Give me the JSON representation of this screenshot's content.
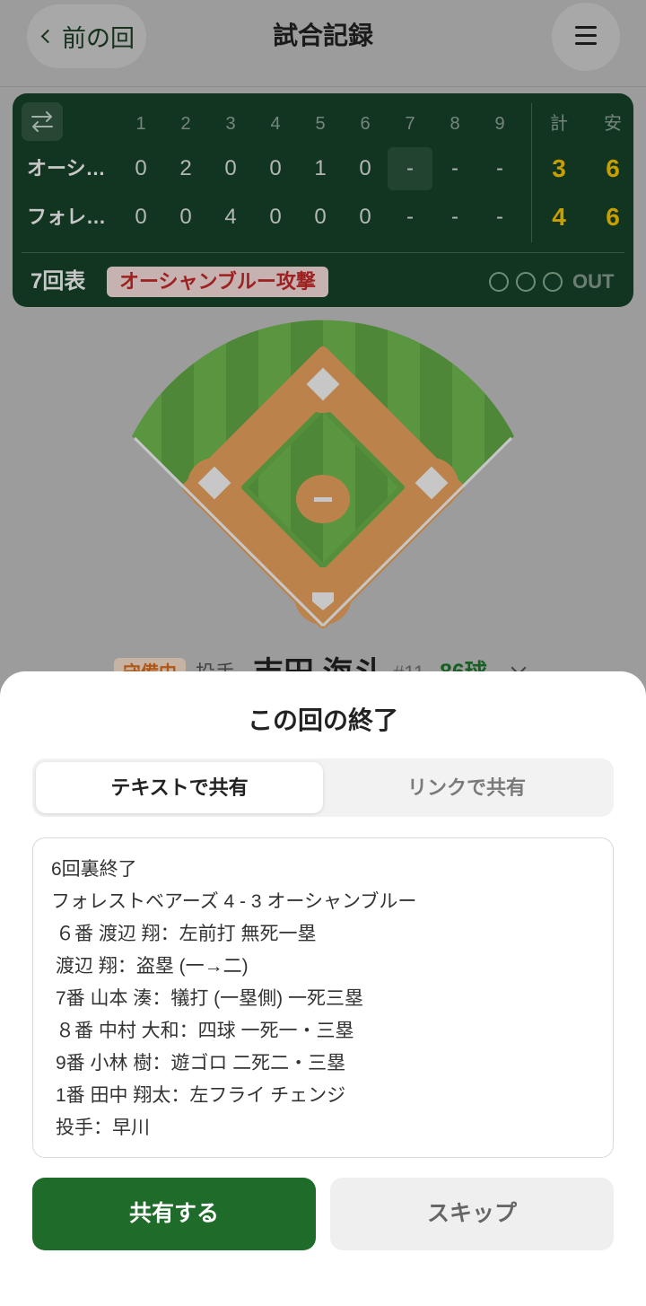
{
  "header": {
    "back_icon": "chevron-left-icon",
    "back_label": "前の回",
    "title": "試合記録",
    "menu_icon": "menu-icon"
  },
  "scoreboard": {
    "swap_icon": "swap-icon",
    "innings": [
      "1",
      "2",
      "3",
      "4",
      "5",
      "6",
      "7",
      "8",
      "9"
    ],
    "total_label": "計",
    "hits_label": "安",
    "teams": [
      {
        "name": "オーシ…",
        "scores": [
          "0",
          "2",
          "0",
          "0",
          "1",
          "0",
          "-",
          "-",
          "-"
        ],
        "total": "3",
        "hits": "6"
      },
      {
        "name": "フォレ…",
        "scores": [
          "0",
          "0",
          "4",
          "0",
          "0",
          "0",
          "-",
          "-",
          "-"
        ],
        "total": "4",
        "hits": "6"
      }
    ],
    "active_cell": {
      "team_index": 0,
      "inning": 7
    },
    "inning_status": "7回表",
    "attack_label": "オーシャンブルー攻撃",
    "outs": 0,
    "out_label": "OUT"
  },
  "defense": {
    "status_badge": "守備中",
    "position": "投手",
    "player_name": "吉田 海斗",
    "uniform_number": "#11",
    "pitch_count": "86球",
    "expand_icon": "chevron-down-icon"
  },
  "modal": {
    "title": "この回の終了",
    "tabs": [
      {
        "label": "テキストで共有",
        "selected": true
      },
      {
        "label": "リンクで共有",
        "selected": false
      }
    ],
    "share_text_lines": [
      "6回裏終了",
      "フォレストベアーズ 4 - 3 オーシャンブルー",
      "６番 渡辺 翔：左前打 無死一塁",
      "渡辺 翔：盗塁 (一→二)",
      "7番 山本 湊：犠打 (一塁側) 一死三塁",
      "８番 中村 大和：四球 一死一・三塁",
      "9番 小林 樹：遊ゴロ 二死二・三塁",
      "1番 田中 翔太：左フライ チェンジ",
      "投手：早川"
    ],
    "share_button": "共有する",
    "skip_button": "スキップ"
  },
  "colors": {
    "accent_green": "#1e6b2a",
    "scoreboard_bg": "#17452a",
    "score_total_yellow": "#ffcc00",
    "attack_badge_red": "#cc2a2a",
    "defense_badge_orange": "#e0701e",
    "pitch_count_green": "#1e7a2e"
  }
}
